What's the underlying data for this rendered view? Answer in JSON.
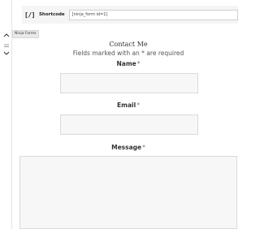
{
  "shortcode_block": {
    "icon": "[/]",
    "label": "Shortcode",
    "value": "[ninja_form id=1]"
  },
  "block_tag": "Ninja Forms",
  "form": {
    "title": "Contact Me",
    "note": "Fields marked with an * are required",
    "fields": [
      {
        "label": "Name",
        "required_mark": "*"
      },
      {
        "label": "Email",
        "required_mark": "*"
      },
      {
        "label": "Message",
        "required_mark": "*"
      }
    ]
  }
}
